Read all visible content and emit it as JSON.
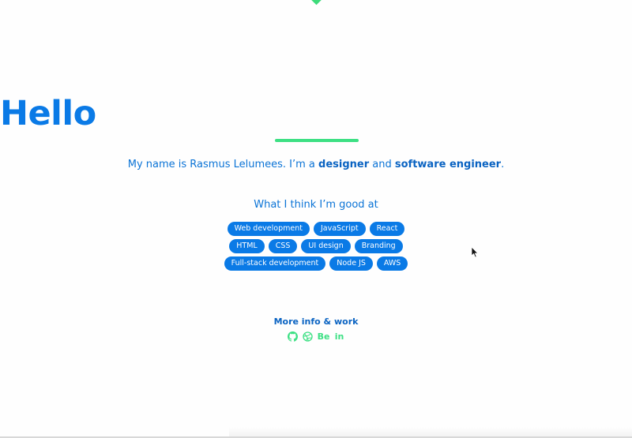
{
  "hero": {
    "title": "Hello",
    "intro_prefix": "My name is Rasmus Lelumees. I’m a ",
    "intro_role1": "designer",
    "intro_and": " and ",
    "intro_role2": "software engineer",
    "intro_suffix": "."
  },
  "skills": {
    "heading": "What I think I’m good at",
    "rows": [
      [
        "Web development",
        "JavaScript",
        "React"
      ],
      [
        "HTML",
        "CSS",
        "UI design",
        "Branding"
      ],
      [
        "Full-stack development",
        "Node JS",
        "AWS"
      ]
    ]
  },
  "footer": {
    "more_label": "More info & work",
    "social": [
      {
        "icon": "github-icon"
      },
      {
        "icon": "dribbble-icon"
      },
      {
        "icon": "behance-icon",
        "text": "Be"
      },
      {
        "icon": "linkedin-icon",
        "text": "in"
      }
    ]
  },
  "colors": {
    "primary": "#0a7ae6",
    "accent": "#3de084",
    "background": "#fefefe"
  }
}
